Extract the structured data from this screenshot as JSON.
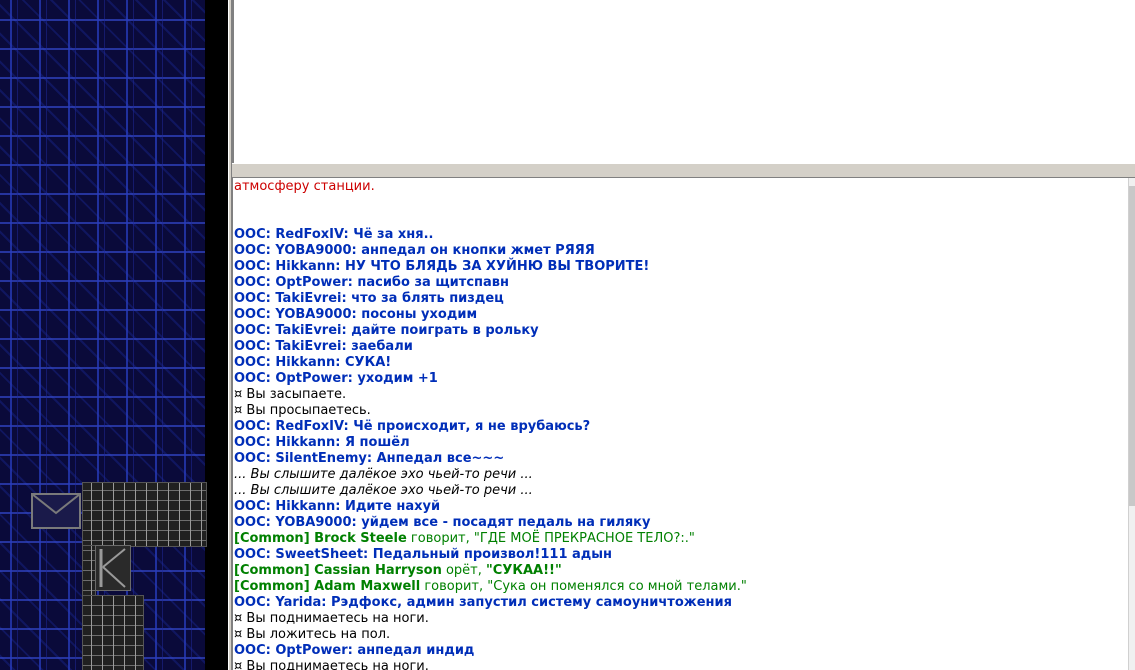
{
  "map": {
    "wall_color": "#0a0a3a",
    "accent": "#2a3cbe",
    "icons": [
      "envelope-icon",
      "door-icon"
    ]
  },
  "chat": {
    "lines": [
      {
        "type": "red",
        "text": "атмосферу станции."
      },
      {
        "type": "blank",
        "text": ""
      },
      {
        "type": "blank",
        "text": ""
      },
      {
        "type": "ooc",
        "text": "OOC: RedFoxIV: Чё за хня.."
      },
      {
        "type": "ooc",
        "text": "OOC: YOBA9000: анпедал он кнопки жмет РЯЯЯ"
      },
      {
        "type": "ooc",
        "text": "OOC: Hikkann: НУ ЧТО БЛЯДЬ ЗА ХУЙНЮ ВЫ ТВОРИТЕ!"
      },
      {
        "type": "ooc",
        "text": "OOC: OptPower: пасибо за щитспавн"
      },
      {
        "type": "ooc",
        "text": "OOC: TakiEvrei: что за блять пиздец"
      },
      {
        "type": "ooc",
        "text": "OOC: YOBA9000: посоны уходим"
      },
      {
        "type": "ooc",
        "text": "OOC: TakiEvrei: дайте поиграть в рольку"
      },
      {
        "type": "ooc",
        "text": "OOC: TakiEvrei: заебали"
      },
      {
        "type": "ooc",
        "text": "OOC: Hikkann: СУКА!"
      },
      {
        "type": "ooc",
        "text": "OOC: OptPower: уходим +1"
      },
      {
        "type": "system",
        "text": "¤ Вы засыпаете."
      },
      {
        "type": "system",
        "text": "¤ Вы просыпаетесь."
      },
      {
        "type": "ooc",
        "text": "OOC: RedFoxIV: Чё происходит, я не врубаюсь?"
      },
      {
        "type": "ooc",
        "text": "OOC: Hikkann: Я пошёл"
      },
      {
        "type": "ooc",
        "text": "OOC: SilentEnemy: Анпедал все~~~"
      },
      {
        "type": "italic",
        "text": "... Вы слышите далёкое эхо чьей-то речи ..."
      },
      {
        "type": "italic",
        "text": "... Вы слышите далёкое эхо чьей-то речи ..."
      },
      {
        "type": "ooc",
        "text": "OOC: Hikkann: Идите нахуй"
      },
      {
        "type": "ooc",
        "text": "OOC: YOBA9000: уйдем все - посадят педаль на гиляку"
      },
      {
        "type": "common",
        "name": "[Common] Brock Steele",
        "verb": " говорит, ",
        "msg": "\"ГДЕ МОЁ ПРЕКРАСНОЕ ТЕЛО?:.\"",
        "bold": false
      },
      {
        "type": "ooc",
        "text": "OOC: SweetSheet: Педальный произвол!111 адын"
      },
      {
        "type": "common",
        "name": "[Common] Cassian Harryson",
        "verb": " орёт, ",
        "msg": "\"СУКАА!!\"",
        "bold": true
      },
      {
        "type": "common",
        "name": "[Common] Adam Maxwell",
        "verb": " говорит, ",
        "msg": "\"Сука он поменялся со мной телами.\"",
        "bold": false
      },
      {
        "type": "ooc",
        "text": "OOC: Yarida: Рэдфокс, админ запустил систему самоуничтожения"
      },
      {
        "type": "system",
        "text": "¤ Вы поднимаетесь на ноги."
      },
      {
        "type": "system",
        "text": "¤ Вы ложитесь на пол."
      },
      {
        "type": "ooc",
        "text": "OOC: OptPower: анпедал индид"
      },
      {
        "type": "system",
        "text": "¤ Вы поднимаетесь на ноги."
      }
    ]
  }
}
